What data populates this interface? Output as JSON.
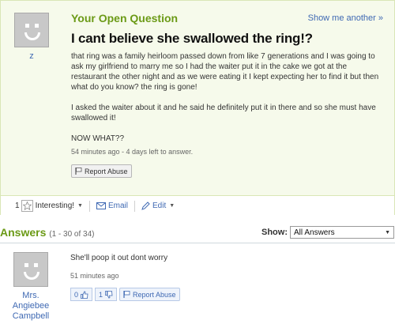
{
  "question": {
    "heading": "Your Open Question",
    "show_another": "Show me another »",
    "user": "z",
    "title": "I cant believe she swallowed the ring!?",
    "body": [
      "that ring was a family heirloom passed down from like 7 generations and I was going to ask my girlfriend to marry me so I had the waiter put it in the cake we got at the restaurant the other night and as we were eating it I kept expecting her to find it but then what do you know? the ring is gone!",
      "I asked the waiter about it and he said he definitely put it in there and so she must have swallowed it!",
      "NOW WHAT??"
    ],
    "meta": "54 minutes ago - 4 days left to answer.",
    "report_label": "Report Abuse"
  },
  "actions": {
    "interesting_count": "1",
    "interesting_label": "Interesting!",
    "email_label": "Email",
    "edit_label": "Edit"
  },
  "answers": {
    "heading": "Answers",
    "range": "(1 - 30 of 34)",
    "show_label": "Show:",
    "filter_value": "All Answers",
    "items": [
      {
        "user": "Mrs. Angiebee Campbell",
        "text": "She'll poop it out dont worry",
        "time": "51 minutes ago",
        "thumbs_up": "0",
        "thumbs_down": "1",
        "report_label": "Report Abuse"
      }
    ]
  },
  "colors": {
    "accent_green": "#6b9a16",
    "link_blue": "#3f69b3",
    "panel_bg": "#f6faeb"
  }
}
